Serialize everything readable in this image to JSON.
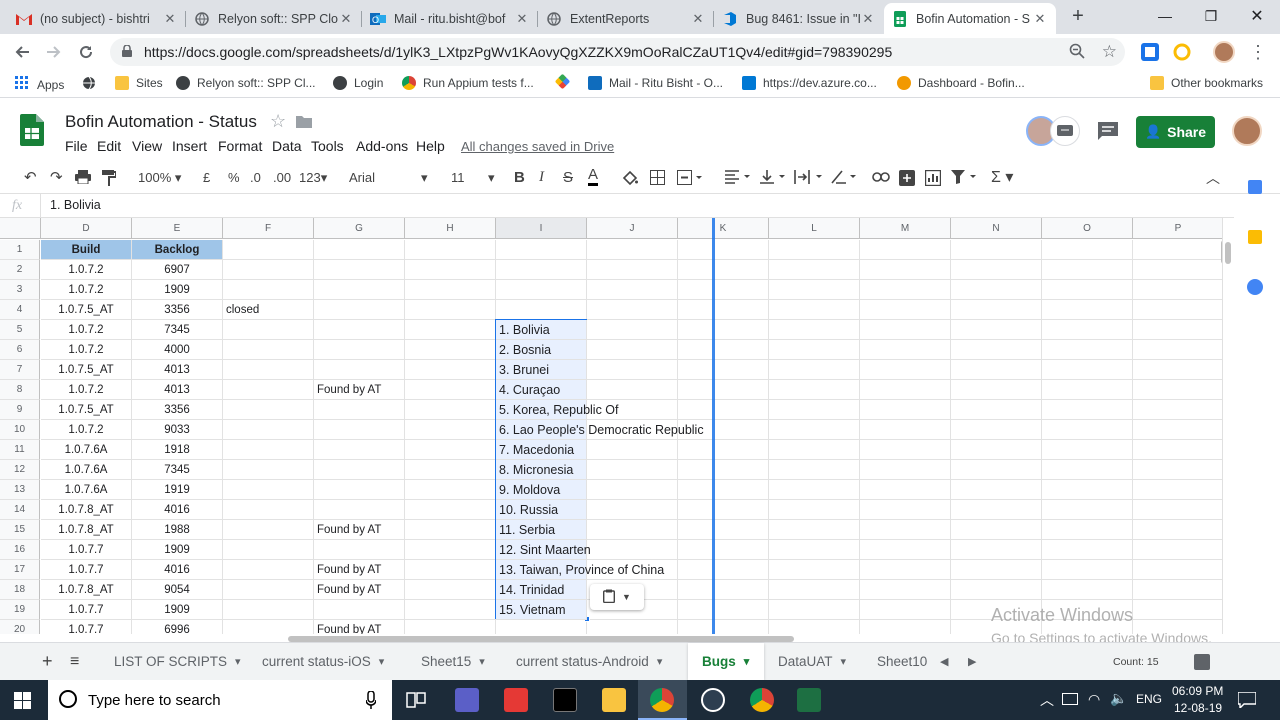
{
  "browser": {
    "tabs": [
      {
        "title": "(no subject) - bishtri",
        "icon": "gmail-icon",
        "color": "#d93025"
      },
      {
        "title": "Relyon soft:: SPP Clo",
        "icon": "globe-icon",
        "color": "#5f6368"
      },
      {
        "title": "Mail - ritu.bisht@bof",
        "icon": "outlook-icon",
        "color": "#0f6cbd"
      },
      {
        "title": "ExtentReports",
        "icon": "globe-icon",
        "color": "#5f6368"
      },
      {
        "title": "Bug 8461: Issue in \"I",
        "icon": "azure-devops-icon",
        "color": "#0078d4"
      },
      {
        "title": "Bofin Automation - S",
        "icon": "sheets-icon",
        "color": "#0f9d58"
      }
    ],
    "new_tab": "+",
    "url": "https://docs.google.com/spreadsheets/d/1ylK3_LXtpzPgWv1KAovyQgXZZKX9mOoRalCZaUT1Qv4/edit#gid=798390295",
    "bookmarks": [
      {
        "label": "Apps",
        "icon": "apps-grid-icon"
      },
      {
        "label": "",
        "icon": "globe-icon"
      },
      {
        "label": "Sites",
        "icon": "folder-icon"
      },
      {
        "label": "Relyon soft:: SPP Cl...",
        "icon": "globe-icon"
      },
      {
        "label": "Login",
        "icon": "globe-icon"
      },
      {
        "label": "Run Appium tests f...",
        "icon": "chrome-icon"
      },
      {
        "label": "",
        "icon": "google-icon"
      },
      {
        "label": "Mail - Ritu Bisht - O...",
        "icon": "outlook-icon"
      },
      {
        "label": "https://dev.azure.co...",
        "icon": "azure-devops-icon"
      },
      {
        "label": "Dashboard - Bofin...",
        "icon": "bofin-icon"
      }
    ],
    "other_bookmarks": "Other bookmarks"
  },
  "sheets": {
    "title": "Bofin Automation - Status",
    "menu": [
      "File",
      "Edit",
      "View",
      "Insert",
      "Format",
      "Data",
      "Tools",
      "Add-ons",
      "Help"
    ],
    "saved_status": "All changes saved in Drive",
    "share_label": "Share",
    "zoom": "100%",
    "currency": "£",
    "percent": "%",
    "dec_less": ".0",
    "dec_more": ".00",
    "num_format": "123",
    "font": "Arial",
    "font_size": "11",
    "fx_label": "fx",
    "formula_value": "1. Bolivia",
    "columns": [
      "D",
      "E",
      "F",
      "G",
      "H",
      "I",
      "J",
      "K",
      "L",
      "M",
      "N",
      "O",
      "P"
    ],
    "header_row": {
      "build": "Build",
      "backlog": "Backlog"
    },
    "rows": [
      {
        "n": "2",
        "d": "1.0.7.2",
        "e": "6907",
        "f": "",
        "g": "",
        "i": ""
      },
      {
        "n": "3",
        "d": "1.0.7.2",
        "e": "1909",
        "f": "",
        "g": "",
        "i": ""
      },
      {
        "n": "4",
        "d": "1.0.7.5_AT",
        "e": "3356",
        "f": "closed",
        "g": "",
        "i": ""
      },
      {
        "n": "5",
        "d": "1.0.7.2",
        "e": "7345",
        "f": "",
        "g": "",
        "i": "1. Bolivia"
      },
      {
        "n": "6",
        "d": "1.0.7.2",
        "e": "4000",
        "f": "",
        "g": "",
        "i": "2. Bosnia"
      },
      {
        "n": "7",
        "d": "1.0.7.5_AT",
        "e": "4013",
        "f": "",
        "g": "",
        "i": "3. Brunei"
      },
      {
        "n": "8",
        "d": "1.0.7.2",
        "e": "4013",
        "f": "",
        "g": "Found by AT",
        "i": "4. Curaçao"
      },
      {
        "n": "9",
        "d": "1.0.7.5_AT",
        "e": "3356",
        "f": "",
        "g": "",
        "i": "5. Korea, Republic Of"
      },
      {
        "n": "10",
        "d": "1.0.7.2",
        "e": "9033",
        "f": "",
        "g": "",
        "i": "6. Lao People's Democratic Republic"
      },
      {
        "n": "11",
        "d": "1.0.7.6A",
        "e": "1918",
        "f": "",
        "g": "",
        "i": "7. Macedonia"
      },
      {
        "n": "12",
        "d": "1.0.7.6A",
        "e": "7345",
        "f": "",
        "g": "",
        "i": "8. Micronesia"
      },
      {
        "n": "13",
        "d": "1.0.7.6A",
        "e": "1919",
        "f": "",
        "g": "",
        "i": "9. Moldova"
      },
      {
        "n": "14",
        "d": "1.0.7.8_AT",
        "e": "4016",
        "f": "",
        "g": "",
        "i": "10. Russia"
      },
      {
        "n": "15",
        "d": "1.0.7.8_AT",
        "e": "1988",
        "f": "",
        "g": "Found by AT",
        "i": "11. Serbia"
      },
      {
        "n": "16",
        "d": "1.0.7.7",
        "e": "1909",
        "f": "",
        "g": "",
        "i": "12. Sint Maarten"
      },
      {
        "n": "17",
        "d": "1.0.7.7",
        "e": "4016",
        "f": "",
        "g": "Found by AT",
        "i": "13. Taiwan, Province of China"
      },
      {
        "n": "18",
        "d": "1.0.7.8_AT",
        "e": "9054",
        "f": "",
        "g": "Found by AT",
        "i": "14. Trinidad"
      },
      {
        "n": "19",
        "d": "1.0.7.7",
        "e": "1909",
        "f": "",
        "g": "",
        "i": "15. Vietnam"
      },
      {
        "n": "20",
        "d": "1.0.7.7",
        "e": "6996",
        "f": "",
        "g": "Found by AT",
        "i": ""
      }
    ],
    "sheet_tabs": [
      "LIST OF SCRIPTS",
      "current status-iOS",
      "Sheet15",
      "current status-Android",
      "Bugs",
      "DataUAT",
      "Sheet10"
    ],
    "active_sheet": "Bugs",
    "count": "Count: 15",
    "watermark_title": "Activate Windows",
    "watermark_sub": "Go to Settings to activate Windows."
  },
  "taskbar": {
    "search_placeholder": "Type here to search",
    "lang": "ENG",
    "time": "06:09 PM",
    "date": "12-08-19"
  },
  "colors": {
    "header_blue": "#9fc5e8",
    "selection": "#e8f0fe",
    "sheets_green": "#188038",
    "share_green": "#188038"
  }
}
